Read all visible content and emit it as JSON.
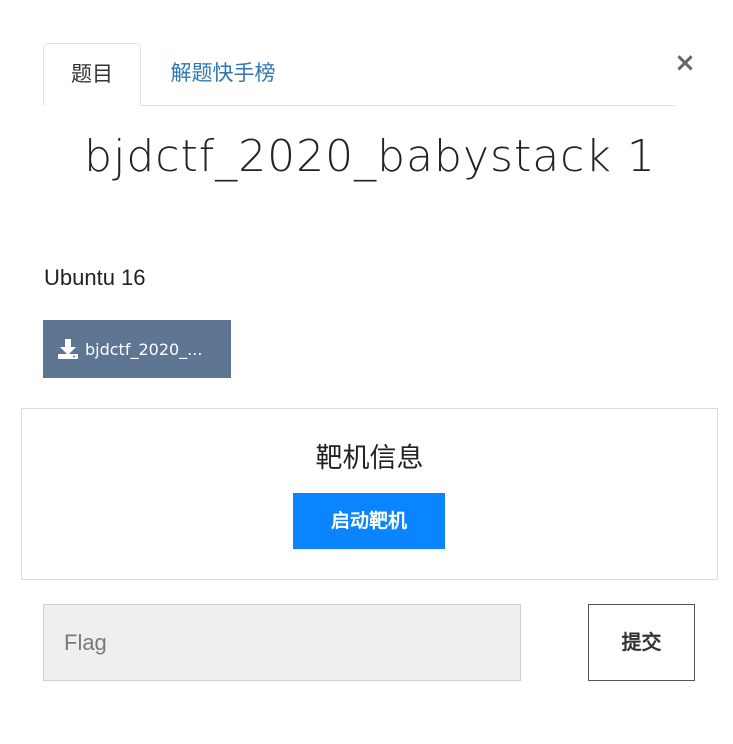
{
  "modal": {
    "close_label": "×",
    "close_icon": "close-icon"
  },
  "tabs": [
    {
      "label": "题目",
      "active": true
    },
    {
      "label": "解题快手榜",
      "active": false
    }
  ],
  "challenge": {
    "title": "bjdctf_2020_babystack 1",
    "description": "Ubuntu 16",
    "download_label": "bjdctf_2020_...",
    "download_icon": "download-icon"
  },
  "target": {
    "heading": "靶机信息",
    "start_label": "启动靶机"
  },
  "flag": {
    "placeholder": "Flag",
    "value": "",
    "submit_label": "提交"
  },
  "colors": {
    "tab_link": "#2f76b3",
    "download_bg": "#5f7594",
    "start_bg": "#0a84ff",
    "input_bg": "#efefef"
  }
}
